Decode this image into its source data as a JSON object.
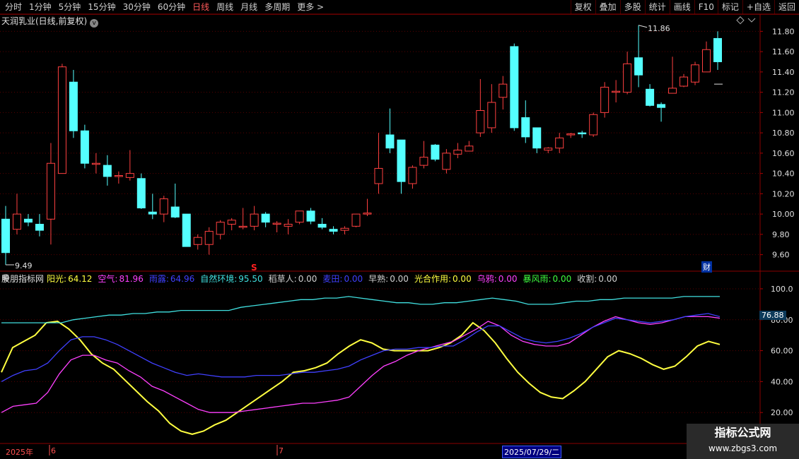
{
  "toolbar": {
    "periods": [
      "分时",
      "1分钟",
      "5分钟",
      "15分钟",
      "30分钟",
      "60分钟",
      "日线",
      "周线",
      "月线",
      "多周期",
      "更多"
    ],
    "active_period": "日线",
    "more_arrow": ">",
    "actions": [
      "复权",
      "叠加",
      "多股",
      "统计",
      "画线",
      "F10",
      "标记",
      "+自选",
      "返回"
    ]
  },
  "stock": {
    "title": "天润乳业(日线,前复权)",
    "chevron": "v"
  },
  "price_axis": {
    "labels": [
      "11.80",
      "11.60",
      "11.40",
      "11.20",
      "11.00",
      "10.80",
      "10.60",
      "10.40",
      "10.20",
      "10.00",
      "9.80",
      "9.60"
    ]
  },
  "price_marks": {
    "high": "11.86",
    "low": "9.49",
    "signal": "S",
    "cai": "财"
  },
  "indicator": {
    "name": "股朋指标网",
    "items": [
      {
        "label": "阳光:",
        "value": "64.12",
        "color": "#ffff40"
      },
      {
        "label": "空气:",
        "value": "81.96",
        "color": "#ff40ff"
      },
      {
        "label": "雨露:",
        "value": "64.96",
        "color": "#4040ff"
      },
      {
        "label": "自然环境:",
        "value": "95.50",
        "color": "#40e0e0"
      },
      {
        "label": "稻草人:",
        "value": "0.00",
        "color": "#d0d0d0"
      },
      {
        "label": "麦田:",
        "value": "0.00",
        "color": "#4040ff"
      },
      {
        "label": "早熟:",
        "value": "0.00",
        "color": "#d0d0d0"
      },
      {
        "label": "光合作用:",
        "value": "0.00",
        "color": "#ffff40"
      },
      {
        "label": "乌鸦:",
        "value": "0.00",
        "color": "#ff40ff"
      },
      {
        "label": "暴风雨:",
        "value": "0.00",
        "color": "#40ff40"
      },
      {
        "label": "收割:",
        "value": "0.00",
        "color": "#d0d0d0"
      }
    ],
    "axis_labels": [
      "100.0",
      "80.00",
      "60.00",
      "40.00",
      "20.00"
    ],
    "current_value": "76.88"
  },
  "timeline": {
    "year": "2025年",
    "month1": "6",
    "month2": "7",
    "cursor_date": "2025/07/29/二"
  },
  "watermark": {
    "line1": "指标公式网",
    "line2": "www.zbgs3.com"
  },
  "colors": {
    "up": "#ff4040",
    "down": "#54ffff",
    "grid": "#5a0000"
  },
  "chart_data": {
    "type": "candlestick",
    "ohlc": [
      [
        9.95,
        10.08,
        9.5,
        9.62
      ],
      [
        9.85,
        10.2,
        9.8,
        10.0
      ],
      [
        9.95,
        10.0,
        9.88,
        9.92
      ],
      [
        9.9,
        10.0,
        9.78,
        9.84
      ],
      [
        9.95,
        10.7,
        9.7,
        10.5
      ],
      [
        10.4,
        11.48,
        10.4,
        11.45
      ],
      [
        11.3,
        11.42,
        10.75,
        10.82
      ],
      [
        10.82,
        10.88,
        10.45,
        10.5
      ],
      [
        10.5,
        10.6,
        10.4,
        10.5
      ],
      [
        10.48,
        10.58,
        10.28,
        10.37
      ],
      [
        10.37,
        10.42,
        10.3,
        10.38
      ],
      [
        10.36,
        10.63,
        10.33,
        10.4
      ],
      [
        10.35,
        10.4,
        10.05,
        10.06
      ],
      [
        10.02,
        10.2,
        9.95,
        10.0
      ],
      [
        10.0,
        10.18,
        9.92,
        10.15
      ],
      [
        10.07,
        10.3,
        9.96,
        9.97
      ],
      [
        10.0,
        10.0,
        9.68,
        9.68
      ],
      [
        9.7,
        9.8,
        9.65,
        9.77
      ],
      [
        9.7,
        9.87,
        9.6,
        9.83
      ],
      [
        9.8,
        9.94,
        9.75,
        9.92
      ],
      [
        9.9,
        9.96,
        9.84,
        9.94
      ],
      [
        9.87,
        10.06,
        9.85,
        9.88
      ],
      [
        9.88,
        10.08,
        9.84,
        10.0
      ],
      [
        10.0,
        10.02,
        9.87,
        9.92
      ],
      [
        9.9,
        9.93,
        9.82,
        9.91
      ],
      [
        9.88,
        9.95,
        9.8,
        9.9
      ],
      [
        9.92,
        10.02,
        9.9,
        10.03
      ],
      [
        10.03,
        10.06,
        9.9,
        9.93
      ],
      [
        9.9,
        9.96,
        9.85,
        9.87
      ],
      [
        9.85,
        9.88,
        9.8,
        9.83
      ],
      [
        9.84,
        9.88,
        9.8,
        9.86
      ],
      [
        9.88,
        10.0,
        9.87,
        10.0
      ],
      [
        10.0,
        10.15,
        9.98,
        10.01
      ],
      [
        10.3,
        10.8,
        10.2,
        10.45
      ],
      [
        10.78,
        11.04,
        10.6,
        10.65
      ],
      [
        10.73,
        10.73,
        10.2,
        10.32
      ],
      [
        10.3,
        10.48,
        10.25,
        10.46
      ],
      [
        10.48,
        10.72,
        10.45,
        10.56
      ],
      [
        10.68,
        10.69,
        10.52,
        10.54
      ],
      [
        10.44,
        10.64,
        10.4,
        10.6
      ],
      [
        10.59,
        10.7,
        10.55,
        10.63
      ],
      [
        10.62,
        10.72,
        10.62,
        10.67
      ],
      [
        10.8,
        11.33,
        10.76,
        11.02
      ],
      [
        10.85,
        11.28,
        10.8,
        11.1
      ],
      [
        11.15,
        11.36,
        11.03,
        11.28
      ],
      [
        11.65,
        11.68,
        10.82,
        10.85
      ],
      [
        10.95,
        11.12,
        10.7,
        10.76
      ],
      [
        10.85,
        10.85,
        10.6,
        10.65
      ],
      [
        10.63,
        10.66,
        10.6,
        10.65
      ],
      [
        10.65,
        10.8,
        10.6,
        10.75
      ],
      [
        10.78,
        10.8,
        10.75,
        10.79
      ],
      [
        10.8,
        10.82,
        10.75,
        10.79
      ],
      [
        10.78,
        11.0,
        10.76,
        10.98
      ],
      [
        11.0,
        11.3,
        10.95,
        11.25
      ],
      [
        11.2,
        11.32,
        11.1,
        11.21
      ],
      [
        11.2,
        11.6,
        11.18,
        11.48
      ],
      [
        11.54,
        11.86,
        11.25,
        11.37
      ],
      [
        11.23,
        11.28,
        11.06,
        11.07
      ],
      [
        11.08,
        11.1,
        10.91,
        11.05
      ],
      [
        11.19,
        11.55,
        11.19,
        11.24
      ],
      [
        11.26,
        11.38,
        11.25,
        11.35
      ],
      [
        11.3,
        11.5,
        11.27,
        11.47
      ],
      [
        11.4,
        11.7,
        11.4,
        11.62
      ],
      [
        11.73,
        11.8,
        11.42,
        11.5
      ]
    ],
    "indicator_series": [
      {
        "name": "阳光",
        "color": "#ffff40",
        "values": [
          46,
          62,
          66,
          70,
          78,
          79,
          74,
          67,
          58,
          52,
          48,
          41,
          34,
          27,
          21,
          13,
          8,
          6,
          8,
          12,
          15,
          20,
          25,
          30,
          35,
          40,
          46,
          47,
          49,
          52,
          58,
          63,
          67,
          65,
          61,
          60,
          60,
          60,
          60,
          62,
          65,
          70,
          78,
          73,
          65,
          55,
          46,
          39,
          33,
          30,
          29,
          34,
          40,
          48,
          56,
          60,
          58,
          55,
          51,
          48,
          50,
          56,
          63,
          66,
          64
        ]
      },
      {
        "name": "空气",
        "color": "#ff40ff",
        "values": [
          20,
          24,
          25,
          26,
          33,
          45,
          54,
          57,
          57,
          54,
          52,
          47,
          43,
          37,
          34,
          30,
          26,
          22,
          20,
          20,
          20,
          21,
          22,
          23,
          24,
          25,
          26,
          26,
          27,
          28,
          30,
          37,
          44,
          50,
          53,
          57,
          60,
          62,
          64,
          66,
          70,
          74,
          79,
          76,
          70,
          66,
          64,
          63,
          63,
          65,
          70,
          75,
          79,
          82,
          80,
          78,
          77,
          78,
          80,
          82,
          82,
          82,
          81
        ]
      },
      {
        "name": "雨露",
        "color": "#4040ff",
        "values": [
          40,
          44,
          47,
          48,
          52,
          60,
          67,
          69,
          69,
          67,
          64,
          60,
          56,
          52,
          49,
          46,
          44,
          45,
          44,
          43,
          43,
          43,
          44,
          44,
          44,
          45,
          46,
          46,
          47,
          48,
          50,
          54,
          57,
          60,
          61,
          61,
          62,
          62,
          63,
          63,
          67,
          72,
          76,
          76,
          72,
          68,
          66,
          65,
          66,
          68,
          71,
          75,
          78,
          81,
          80,
          79,
          78,
          79,
          80,
          82,
          83,
          84,
          82
        ]
      },
      {
        "name": "自然环境",
        "color": "#40e0e0",
        "values": [
          78,
          78,
          78,
          78,
          78,
          78,
          80,
          81,
          82,
          83,
          83,
          84,
          84,
          85,
          85,
          86,
          86,
          86,
          86,
          86,
          88,
          89,
          90,
          91,
          92,
          93,
          93,
          94,
          94,
          95,
          94,
          93,
          92,
          91,
          91,
          90,
          90,
          91,
          91,
          92,
          93,
          94,
          93,
          92,
          90,
          90,
          90,
          91,
          92,
          92,
          93,
          93,
          94,
          94,
          94,
          94,
          94,
          95,
          95,
          95,
          95
        ]
      }
    ],
    "price_ylim": [
      9.5,
      11.9
    ],
    "indicator_ylim": [
      0,
      105
    ]
  }
}
